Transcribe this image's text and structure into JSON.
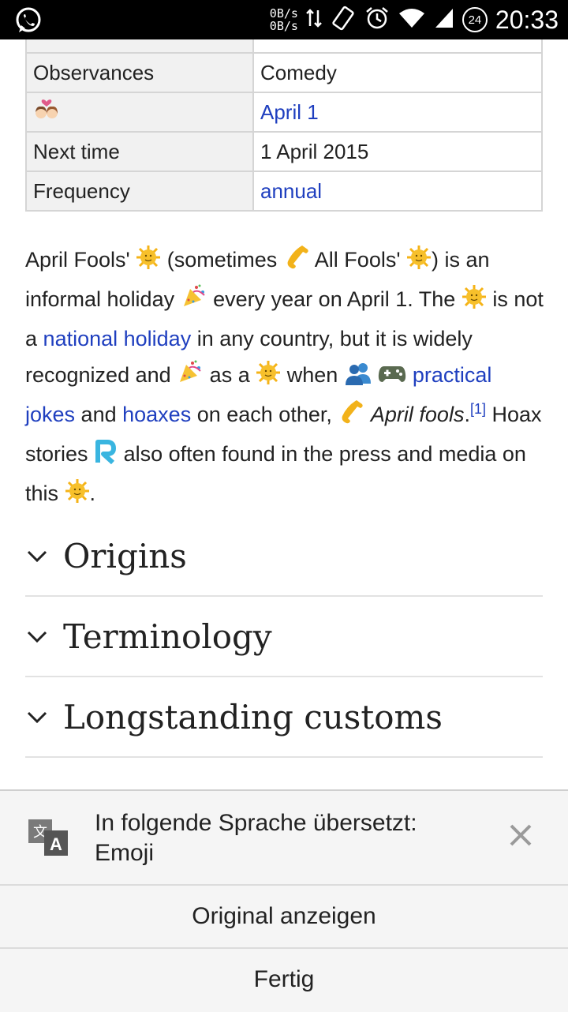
{
  "status_bar": {
    "net_up": "0B/s",
    "net_down": "0B/s",
    "notification_count": "24",
    "time": "20:33"
  },
  "infobox": {
    "rows": [
      {
        "key": "Observances",
        "value": "Comedy",
        "value_is_link": false
      },
      {
        "key": "",
        "key_icon": "couple-emoji",
        "value": "April 1",
        "value_is_link": true
      },
      {
        "key": "Next time",
        "value": "1 April 2015",
        "value_is_link": false
      },
      {
        "key": "Frequency",
        "value": "annual",
        "value_is_link": true
      }
    ]
  },
  "article": {
    "t1": "April Fools'",
    "t2": "(sometimes",
    "t3": "All Fools'",
    "t4": ") is an informal holiday",
    "t5": "every year on April 1. The",
    "t6": "is not a",
    "link_national_holiday": "national holiday",
    "t7": "in any country, but it is widely recognized and",
    "t8": "as a",
    "t9": "when",
    "link_practical_jokes": "practical jokes",
    "t10": "and",
    "link_hoaxes": "hoaxes",
    "t11": "on each other,",
    "t12_italic": "April fools",
    "t13": ".",
    "ref": "[1]",
    "t14": "Hoax stories",
    "t15": "also often found in the press and media on this",
    "t16": "."
  },
  "sections": [
    {
      "title": "Origins"
    },
    {
      "title": "Terminology"
    },
    {
      "title": "Longstanding customs"
    }
  ],
  "translate_bar": {
    "message": "In folgende Sprache übersetzt:",
    "language": "Emoji",
    "show_original": "Original anzeigen",
    "done": "Fertig"
  },
  "colors": {
    "link": "#1f3fbf",
    "sun": "#f7c02b",
    "phone": "#f2b21a",
    "r_logo": "#39b5e0"
  }
}
